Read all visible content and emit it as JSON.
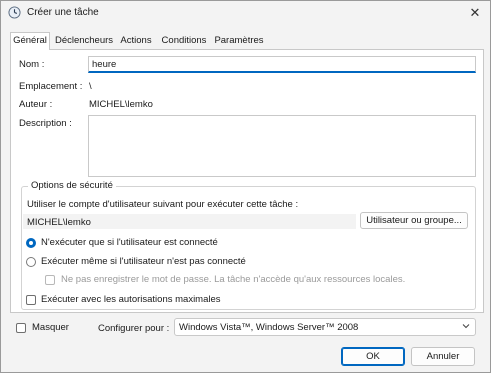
{
  "window": {
    "title": "Créer une tâche",
    "close_glyph": "✕"
  },
  "tabs": [
    {
      "label": "Général",
      "active": true
    },
    {
      "label": "Déclencheurs",
      "active": false
    },
    {
      "label": "Actions",
      "active": false
    },
    {
      "label": "Conditions",
      "active": false
    },
    {
      "label": "Paramètres",
      "active": false
    }
  ],
  "general": {
    "name_label": "Nom :",
    "name_value": "heure",
    "location_label": "Emplacement :",
    "location_value": "\\",
    "author_label": "Auteur :",
    "author_value": "MICHEL\\lemko",
    "description_label": "Description :",
    "description_value": ""
  },
  "security": {
    "group_title": "Options de sécurité",
    "account_prompt": "Utiliser le compte d'utilisateur suivant pour exécuter cette tâche :",
    "account_value": "MICHEL\\lemko",
    "change_user_button": "Utilisateur ou groupe...",
    "radio_logged_on": "N'exécuter que si l'utilisateur est connecté",
    "radio_always": "Exécuter même si l'utilisateur n'est pas connecté",
    "no_store_password": "Ne pas enregistrer le mot de passe. La tâche n'accède qu'aux ressources locales.",
    "highest_privileges": "Exécuter avec les autorisations maximales"
  },
  "footer": {
    "hidden_label": "Masquer",
    "configure_label": "Configurer pour :",
    "configure_value": "Windows Vista™, Windows Server™ 2008",
    "ok_button": "OK",
    "cancel_button": "Annuler"
  },
  "colors": {
    "accent": "#0067c0"
  },
  "icons": {
    "title": "task-scheduler-clock-icon",
    "close": "close-icon",
    "dropdown": "chevron-down-icon"
  }
}
